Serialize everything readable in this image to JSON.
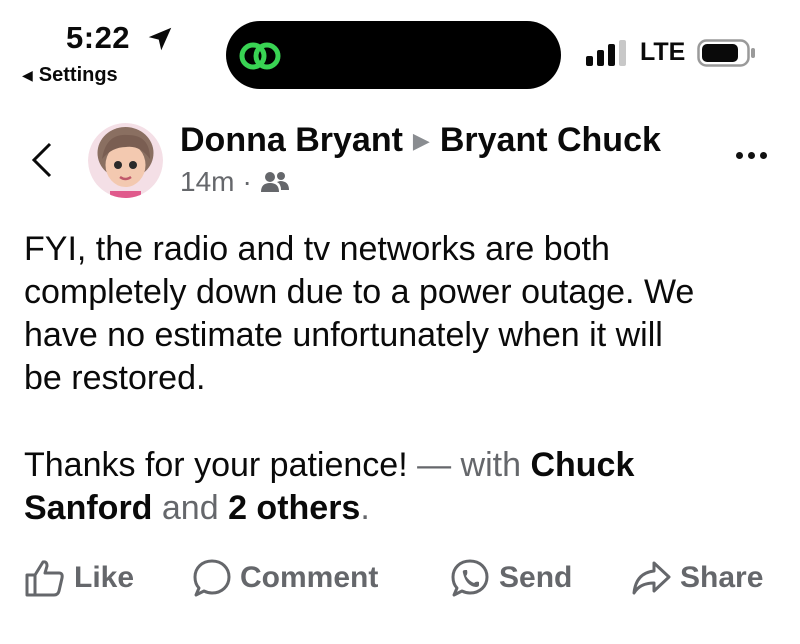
{
  "status_bar": {
    "time": "5:22",
    "back_label": "Settings",
    "network": "LTE"
  },
  "post": {
    "author": "Donna Bryant",
    "target": "Bryant Chuck",
    "timestamp": "14m",
    "text_lines": [
      "FYI, the radio and tv networks are both",
      "completely down due to a power outage. We",
      "have no estimate unfortunately when it will",
      "be restored."
    ],
    "thanks": {
      "prefix": "Thanks for your patience!",
      "with": " — with ",
      "name1_a": "Chuck",
      "name1_b": "Sanford",
      "and": " and ",
      "others": "2 others",
      "period": "."
    }
  },
  "actions": {
    "like": "Like",
    "comment": "Comment",
    "send": "Send",
    "share": "Share"
  },
  "icons": {
    "location": "location-arrow-icon",
    "island_app": "link-app-icon",
    "signal": "signal-icon",
    "battery": "battery-icon",
    "audience": "friends-icon"
  },
  "colors": {
    "island_icon": "#39d353",
    "secondary_text": "#65676b"
  }
}
